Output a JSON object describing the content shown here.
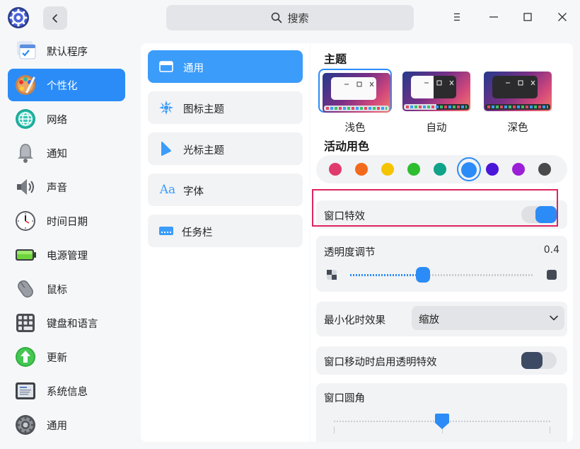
{
  "titlebar": {
    "search_placeholder": "搜索",
    "icons": [
      "app-logo",
      "back-arrow",
      "search-icon",
      "menu-icon",
      "minimize-icon",
      "maximize-icon",
      "close-icon"
    ]
  },
  "sidebar": {
    "items": [
      {
        "label": "默认程序",
        "icon": "default-apps-icon"
      },
      {
        "label": "个性化",
        "icon": "personalization-icon",
        "active": true
      },
      {
        "label": "网络",
        "icon": "network-icon"
      },
      {
        "label": "通知",
        "icon": "notification-bell-icon"
      },
      {
        "label": "声音",
        "icon": "speaker-icon"
      },
      {
        "label": "时间日期",
        "icon": "clock-icon"
      },
      {
        "label": "电源管理",
        "icon": "battery-icon"
      },
      {
        "label": "鼠标",
        "icon": "mouse-icon"
      },
      {
        "label": "键盘和语言",
        "icon": "keyboard-icon"
      },
      {
        "label": "更新",
        "icon": "update-icon"
      },
      {
        "label": "系统信息",
        "icon": "system-info-icon"
      },
      {
        "label": "通用",
        "icon": "general-settings-icon"
      }
    ]
  },
  "subnav": {
    "items": [
      {
        "label": "通用",
        "icon": "window-icon",
        "active": true
      },
      {
        "label": "图标主题",
        "icon": "icon-theme-icon"
      },
      {
        "label": "光标主题",
        "icon": "cursor-icon"
      },
      {
        "label": "字体",
        "icon": "font-icon",
        "glyph": "Aa"
      },
      {
        "label": "任务栏",
        "icon": "taskbar-icon"
      }
    ]
  },
  "theme": {
    "title": "主题",
    "options": [
      {
        "label": "浅色",
        "selected": true
      },
      {
        "label": "自动",
        "selected": false
      },
      {
        "label": "深色",
        "selected": false
      }
    ]
  },
  "accent": {
    "title": "活动用色",
    "colors": [
      "#e03a6e",
      "#f26a1b",
      "#f5c400",
      "#2ebd2e",
      "#0ea38a",
      "#2b8cf7",
      "#4b16d8",
      "#9b1fd6",
      "#4a4a4a"
    ],
    "selected_index": 5
  },
  "window_effect": {
    "label": "窗口特效",
    "enabled": true
  },
  "transparency": {
    "label": "透明度调节",
    "value": "0.4",
    "fraction": 0.4
  },
  "minimize": {
    "label": "最小化时效果",
    "value": "缩放"
  },
  "move_transparency": {
    "label": "窗口移动时启用透明特效",
    "enabled": false
  },
  "corner": {
    "label": "窗口圆角",
    "fraction": 0.5
  },
  "colors": {
    "accent": "#2b8cf7",
    "highlight_border": "#e0245e",
    "toggle_off": "#3d4a63"
  }
}
